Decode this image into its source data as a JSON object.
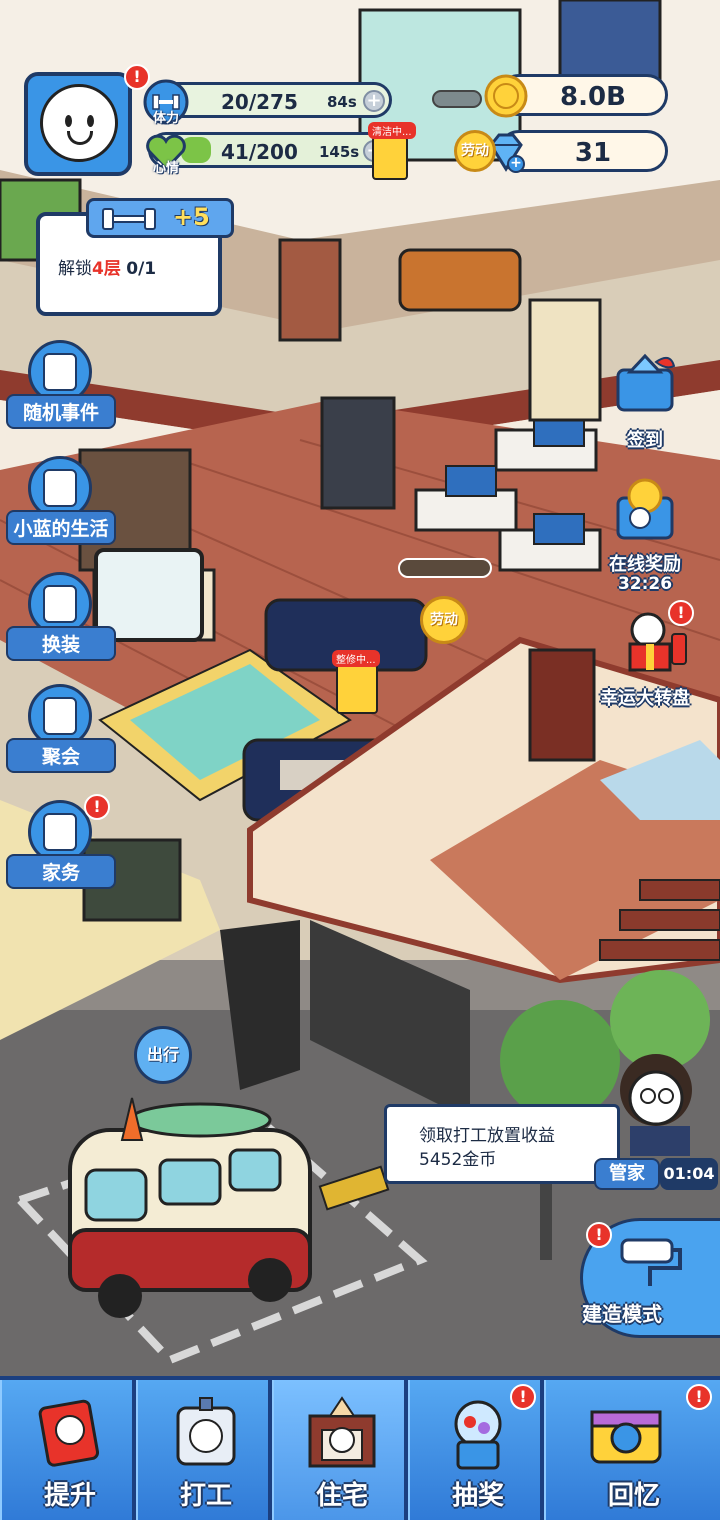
{
  "player": {
    "stamina_label": "体力",
    "stamina": "20/275",
    "stamina_timer": "84s",
    "mood_label": "心情",
    "mood": "41/200",
    "mood_timer": "145s",
    "avatar_alert": "!"
  },
  "resources": {
    "gold": "8.0B",
    "diamonds": "31"
  },
  "quest": {
    "reward": "+5",
    "text_prefix": "解锁",
    "text_highlight": "4层",
    "progress": "0/1"
  },
  "side_menu": [
    {
      "label": "随机事件",
      "alert": ""
    },
    {
      "label": "小蓝的生活",
      "alert": ""
    },
    {
      "label": "换装",
      "alert": ""
    },
    {
      "label": "聚会",
      "alert": ""
    },
    {
      "label": "家务",
      "alert": "!"
    }
  ],
  "right_buttons": {
    "checkin": "签到",
    "online_reward": "在线奖励",
    "online_timer": "32:26",
    "wheel": "幸运大转盘",
    "wheel_alert": "!"
  },
  "scene": {
    "work_chip": "劳动",
    "cleaning_sign": "清洁中...",
    "repair_sign": "整修中..."
  },
  "butler": {
    "line1": "领取打工放置收益",
    "line2": "5452金币",
    "tag": "管家",
    "timer": "01:04"
  },
  "go_button": "出行",
  "build": {
    "label": "建造模式",
    "alert": "!"
  },
  "nav": [
    {
      "label": "提升",
      "alert": ""
    },
    {
      "label": "打工",
      "alert": ""
    },
    {
      "label": "住宅",
      "alert": "",
      "active": true
    },
    {
      "label": "抽奖",
      "alert": "!"
    },
    {
      "label": "回忆",
      "alert": "!"
    }
  ],
  "colors": {
    "primary_blue": "#3a95e6",
    "outline_navy": "#1f3a66",
    "alert_red": "#e8332a",
    "coin_gold": "#ffd23a"
  }
}
